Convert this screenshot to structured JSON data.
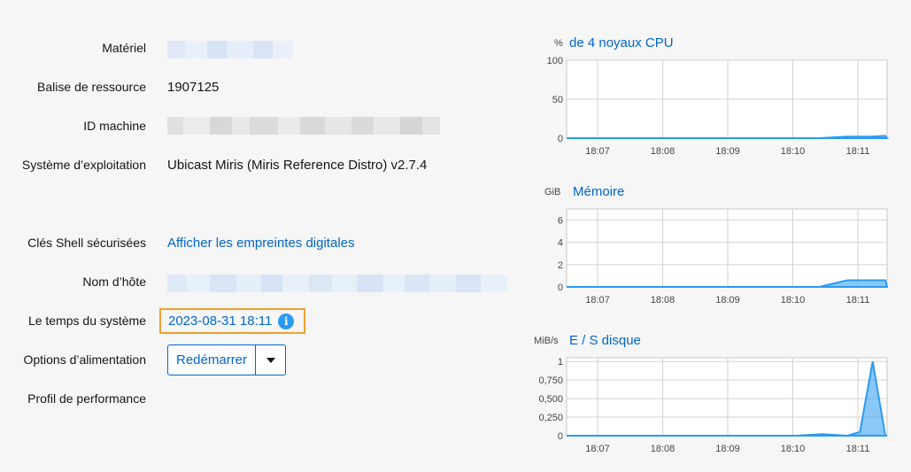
{
  "info": {
    "hardware_label": "Matériel",
    "asset_tag_label": "Balise de ressource",
    "asset_tag_value": "1907125",
    "machine_id_label": "ID machine",
    "os_label": "Système d’exploitation",
    "os_value": "Ubicast Miris (Miris Reference Distro) v2.7.4",
    "ssh_label": "Clés Shell sécurisées",
    "ssh_link": "Afficher les empreintes digitales",
    "hostname_label": "Nom d’hôte",
    "time_label": "Le temps du système",
    "time_value": "2023-08-31 18:11",
    "power_label": "Options d’alimentation",
    "power_button": "Redémarrer",
    "profile_label": "Profil de performance"
  },
  "icons": {
    "info": "info-circle-icon",
    "dropdown": "caret-down-icon"
  },
  "colors": {
    "link": "#0066cc",
    "series": "#2b9af3",
    "highlight": "#f0a030"
  },
  "chart_data": [
    {
      "type": "area",
      "title": "de 4 noyaux CPU",
      "ylabel": "%",
      "yticks": [
        "100",
        "50",
        "0"
      ],
      "ylim": [
        0,
        100
      ],
      "x": [
        "18:07",
        "18:08",
        "18:09",
        "18:10",
        "18:11"
      ],
      "series": [
        {
          "values": [
            0,
            0,
            0,
            0,
            0,
            0,
            0,
            0,
            0,
            0,
            2,
            2,
            2,
            3
          ]
        }
      ]
    },
    {
      "type": "area",
      "title": "Mémoire",
      "ylabel": "GiB",
      "yticks": [
        "6",
        "4",
        "2",
        "0"
      ],
      "ylim": [
        0,
        7
      ],
      "x": [
        "18:07",
        "18:08",
        "18:09",
        "18:10",
        "18:11"
      ],
      "series": [
        {
          "values": [
            0,
            0,
            0,
            0,
            0,
            0,
            0,
            0,
            0,
            0,
            0.6,
            0.6,
            0.6,
            0.6
          ]
        }
      ]
    },
    {
      "type": "area",
      "title": "E / S disque",
      "ylabel": "MiB/s",
      "yticks": [
        "1",
        "0,750",
        "0,500",
        "0,250",
        "0"
      ],
      "ylim": [
        0,
        1.05
      ],
      "x": [
        "18:07",
        "18:08",
        "18:09",
        "18:10",
        "18:11"
      ],
      "series": [
        {
          "values": [
            0,
            0,
            0,
            0,
            0,
            0,
            0,
            0,
            0,
            0,
            0.02,
            0,
            0.05,
            1.0,
            0
          ]
        }
      ]
    }
  ]
}
